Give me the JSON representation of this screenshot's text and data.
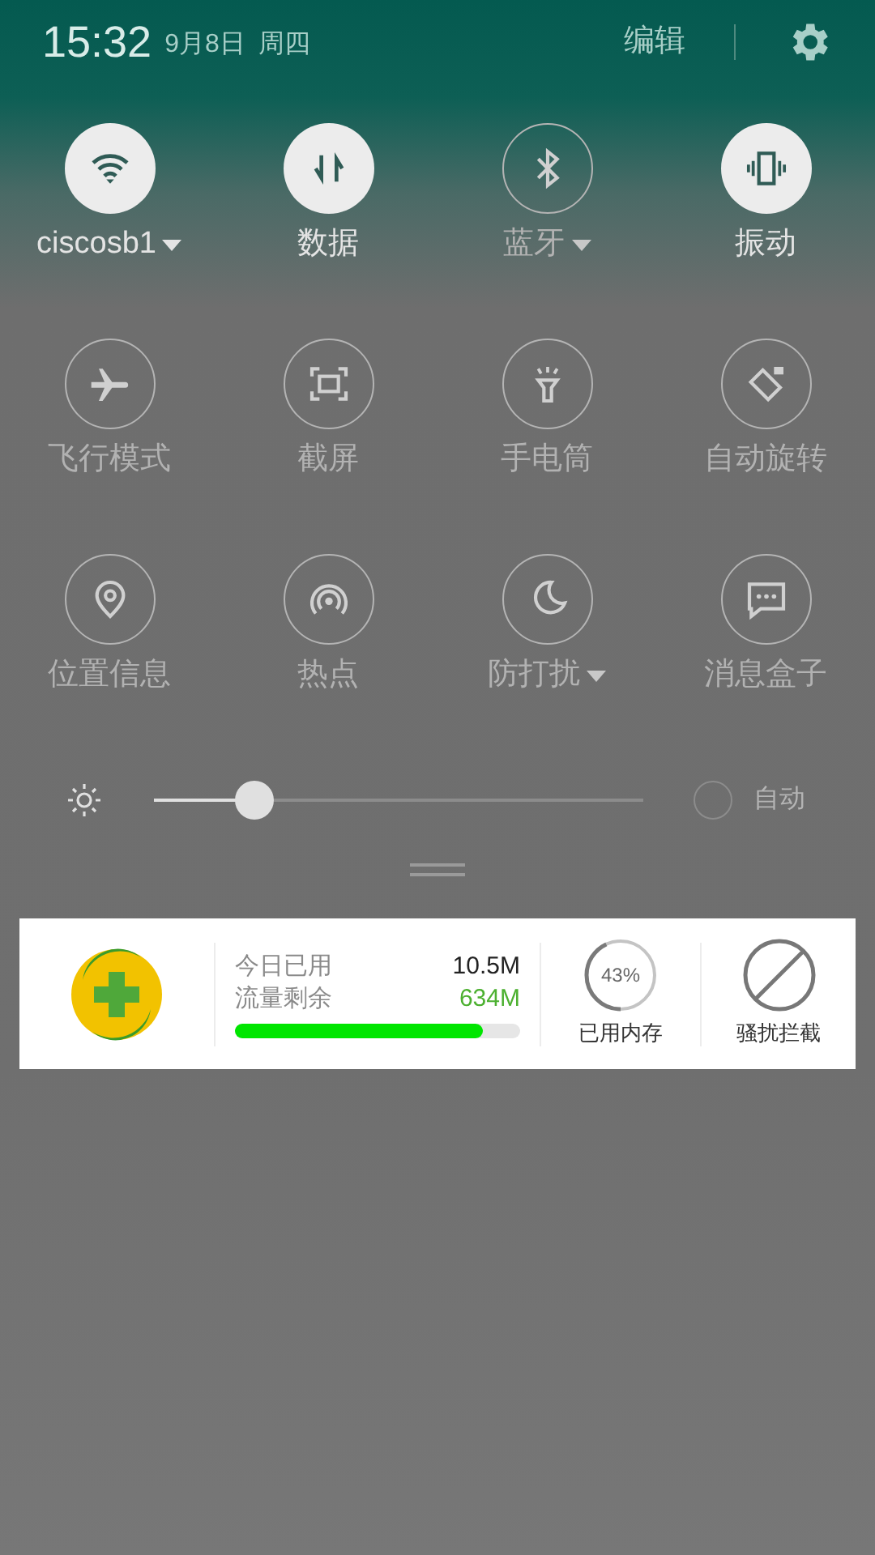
{
  "header": {
    "time": "15:32",
    "date": "9月8日",
    "weekday": "周四",
    "edit": "编辑"
  },
  "tiles": [
    {
      "label": "ciscosb1",
      "on": true,
      "dropdown": true
    },
    {
      "label": "数据",
      "on": true,
      "dropdown": false
    },
    {
      "label": "蓝牙",
      "on": false,
      "dropdown": true
    },
    {
      "label": "振动",
      "on": true,
      "dropdown": false
    },
    {
      "label": "飞行模式",
      "on": false,
      "dropdown": false
    },
    {
      "label": "截屏",
      "on": false,
      "dropdown": false
    },
    {
      "label": "手电筒",
      "on": false,
      "dropdown": false
    },
    {
      "label": "自动旋转",
      "on": false,
      "dropdown": false
    },
    {
      "label": "位置信息",
      "on": false,
      "dropdown": false
    },
    {
      "label": "热点",
      "on": false,
      "dropdown": false
    },
    {
      "label": "防打扰",
      "on": false,
      "dropdown": true
    },
    {
      "label": "消息盒子",
      "on": false,
      "dropdown": false
    }
  ],
  "brightness": {
    "level": 0.205,
    "auto_label": "自动",
    "auto_checked": false
  },
  "widget": {
    "used_label": "今日已用",
    "used_value": "10.5M",
    "remaining_label": "流量剩余",
    "remaining_value": "634M",
    "data_bar": {
      "level": 0.87
    },
    "memory_percent": "43%",
    "memory_ring": {
      "level": 0.43
    },
    "memory_label": "已用内存",
    "block_label": "骚扰拦截"
  }
}
